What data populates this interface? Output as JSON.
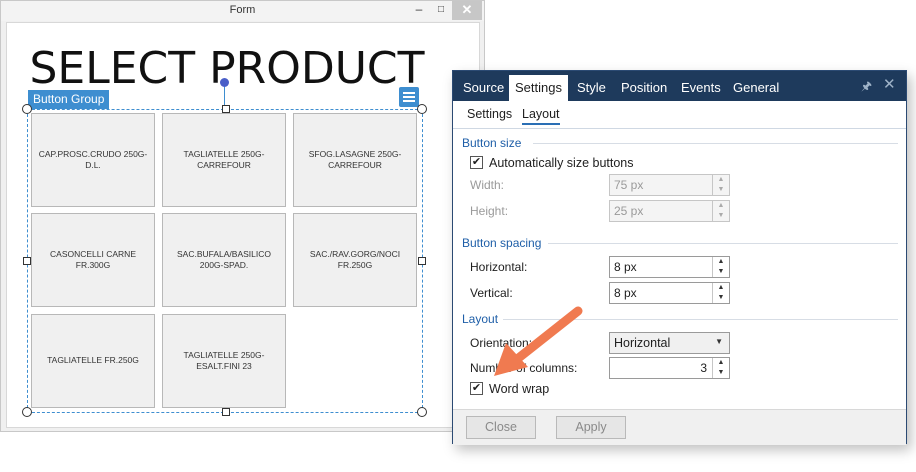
{
  "form_window": {
    "title": "Form",
    "minimize_glyph": "–",
    "maximize_glyph": "□",
    "close_glyph": "✕",
    "canvas": {
      "title": "SELECT PRODUCT",
      "button_group_label": "Button Group",
      "menu_icon": "hamburger-menu-icon",
      "buttons": [
        "CAP.PROSC.CRUDO 250G-D.L.",
        "TAGLIATELLE 250G-CARREFOUR",
        "SFOG.LASAGNE 250G-CARREFOUR",
        "CASONCELLI CARNE FR.300G",
        "SAC.BUFALA/BASILICO 200G-SPAD.",
        "SAC./RAV.GORG/NOCI FR.250G",
        "TAGLIATELLE FR.250G",
        "TAGLIATELLE 250G-ESALT.FINI 23"
      ]
    }
  },
  "panel": {
    "tabs": [
      "Source",
      "Settings",
      "Style",
      "Position",
      "Events",
      "General"
    ],
    "active_tab": "Settings",
    "pin_icon": "pin-icon",
    "close_icon": "close-icon",
    "subtabs": [
      "Settings",
      "Layout"
    ],
    "active_subtab": "Layout",
    "button_size": {
      "title": "Button size",
      "auto_size_label": "Automatically size buttons",
      "auto_size_checked": true,
      "width_label": "Width:",
      "width_value": "75 px",
      "height_label": "Height:",
      "height_value": "25 px"
    },
    "button_spacing": {
      "title": "Button spacing",
      "horizontal_label": "Horizontal:",
      "horizontal_value": "8 px",
      "vertical_label": "Vertical:",
      "vertical_value": "8 px"
    },
    "layout": {
      "title": "Layout",
      "orientation_label": "Orientation:",
      "orientation_value": "Horizontal",
      "columns_label": "Number of columns:",
      "columns_value": "3",
      "word_wrap_label": "Word wrap",
      "word_wrap_checked": true
    },
    "footer": {
      "close_label": "Close",
      "apply_label": "Apply"
    }
  },
  "colors": {
    "panel_header": "#1e3a5c",
    "accent_blue": "#3e8ed0",
    "section_title": "#1f5fa8",
    "annotation_arrow": "#f07a50"
  }
}
